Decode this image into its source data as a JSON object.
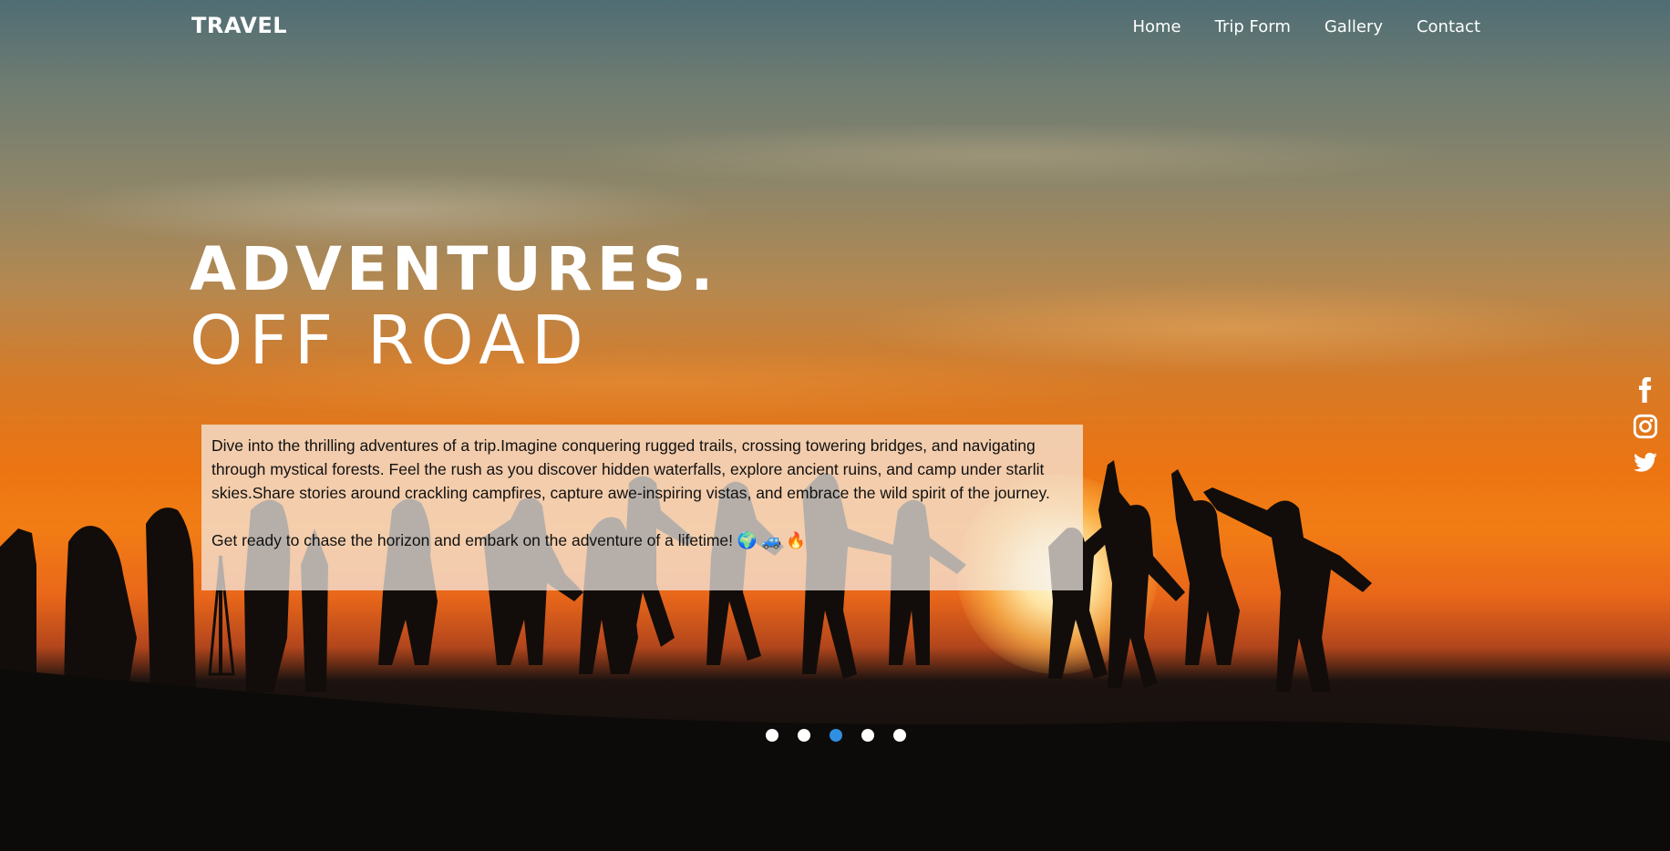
{
  "brand": {
    "logo": "TRAVEL"
  },
  "nav": {
    "items": [
      {
        "label": "Home"
      },
      {
        "label": "Trip Form"
      },
      {
        "label": "Gallery"
      },
      {
        "label": "Contact"
      }
    ]
  },
  "hero": {
    "title_line1": "ADVENTURES.",
    "title_line2": "OFF ROAD",
    "paragraph1": "Dive into the thrilling adventures of a trip.Imagine conquering rugged trails, crossing towering bridges, and navigating through mystical forests. Feel the rush as you discover hidden waterfalls, explore ancient ruins, and camp under starlit skies.Share stories around crackling campfires, capture awe-inspiring vistas, and embrace the wild spirit of the journey.",
    "paragraph2": "Get ready to chase the horizon and embark on the adventure of a lifetime! 🌍 🚙 🔥"
  },
  "social": {
    "icons": [
      "facebook-icon",
      "instagram-icon",
      "twitter-icon"
    ]
  },
  "slider": {
    "count": 5,
    "active_index": 2,
    "active_color": "#2f8fe0"
  },
  "colors": {
    "text_primary": "#ffffff",
    "textbox_bg": "rgba(245,238,232,0.72)"
  }
}
